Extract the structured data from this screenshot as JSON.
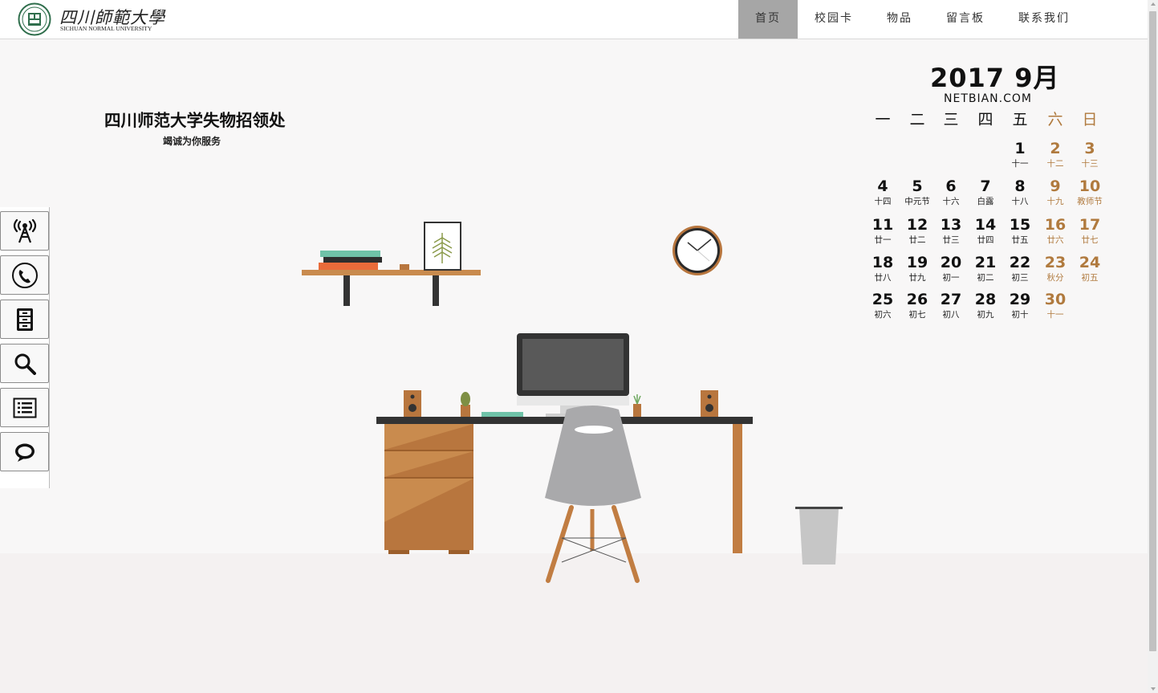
{
  "header": {
    "logo_cn": "四川師範大學",
    "logo_en": "SICHUAN NORMAL UNIVERSITY",
    "nav": [
      {
        "label": "首页",
        "active": true
      },
      {
        "label": "校园卡",
        "active": false
      },
      {
        "label": "物品",
        "active": false
      },
      {
        "label": "留言板",
        "active": false
      },
      {
        "label": "联系我们",
        "active": false
      }
    ]
  },
  "hero": {
    "title": "四川师范大学失物招领处",
    "subtitle": "竭诚为你服务"
  },
  "sidebar": {
    "buttons": [
      {
        "icon": "broadcast-tower-icon"
      },
      {
        "icon": "phone-icon"
      },
      {
        "icon": "file-cabinet-icon"
      },
      {
        "icon": "search-icon"
      },
      {
        "icon": "list-icon"
      },
      {
        "icon": "chat-bubble-icon"
      }
    ]
  },
  "calendar": {
    "year_month": "2017  9月",
    "site": "NETBIAN.COM",
    "weekdays": [
      "一",
      "二",
      "三",
      "四",
      "五",
      "六",
      "日"
    ],
    "weeks": [
      [
        null,
        null,
        null,
        null,
        {
          "d": "1",
          "l": "十一"
        },
        {
          "d": "2",
          "l": "十二"
        },
        {
          "d": "3",
          "l": "十三"
        }
      ],
      [
        {
          "d": "4",
          "l": "十四"
        },
        {
          "d": "5",
          "l": "中元节"
        },
        {
          "d": "6",
          "l": "十六"
        },
        {
          "d": "7",
          "l": "白露"
        },
        {
          "d": "8",
          "l": "十八"
        },
        {
          "d": "9",
          "l": "十九"
        },
        {
          "d": "10",
          "l": "教师节"
        }
      ],
      [
        {
          "d": "11",
          "l": "廿一"
        },
        {
          "d": "12",
          "l": "廿二"
        },
        {
          "d": "13",
          "l": "廿三"
        },
        {
          "d": "14",
          "l": "廿四"
        },
        {
          "d": "15",
          "l": "廿五"
        },
        {
          "d": "16",
          "l": "廿六"
        },
        {
          "d": "17",
          "l": "廿七"
        }
      ],
      [
        {
          "d": "18",
          "l": "廿八"
        },
        {
          "d": "19",
          "l": "廿九"
        },
        {
          "d": "20",
          "l": "初一"
        },
        {
          "d": "21",
          "l": "初二"
        },
        {
          "d": "22",
          "l": "初三"
        },
        {
          "d": "23",
          "l": "秋分"
        },
        {
          "d": "24",
          "l": "初五"
        }
      ],
      [
        {
          "d": "25",
          "l": "初六"
        },
        {
          "d": "26",
          "l": "初七"
        },
        {
          "d": "27",
          "l": "初八"
        },
        {
          "d": "28",
          "l": "初九"
        },
        {
          "d": "29",
          "l": "初十"
        },
        {
          "d": "30",
          "l": "十一"
        },
        null
      ]
    ]
  },
  "colors": {
    "accent_weekend": "#b07a3e",
    "nav_active": "#a6a6a6",
    "wood": "#b8763e",
    "dark": "#3a3a3a"
  }
}
